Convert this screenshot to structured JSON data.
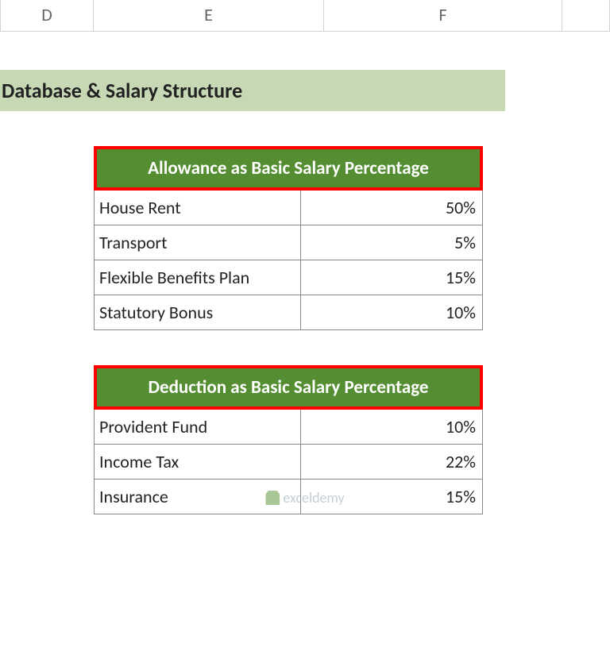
{
  "columns": {
    "D": "D",
    "E": "E",
    "F": "F"
  },
  "title": "Database & Salary Structure",
  "allowance": {
    "header": "Allowance as Basic Salary Percentage",
    "rows": [
      {
        "label": "House Rent",
        "value": "50%"
      },
      {
        "label": "Transport",
        "value": "5%"
      },
      {
        "label": "Flexible Benefits Plan",
        "value": "15%"
      },
      {
        "label": "Statutory Bonus",
        "value": "10%"
      }
    ]
  },
  "deduction": {
    "header": "Deduction as Basic Salary Percentage",
    "rows": [
      {
        "label": "Provident Fund",
        "value": "10%"
      },
      {
        "label": "Income Tax",
        "value": "22%"
      },
      {
        "label": "Insurance",
        "value": "15%"
      }
    ]
  },
  "watermark": "exceldemy"
}
